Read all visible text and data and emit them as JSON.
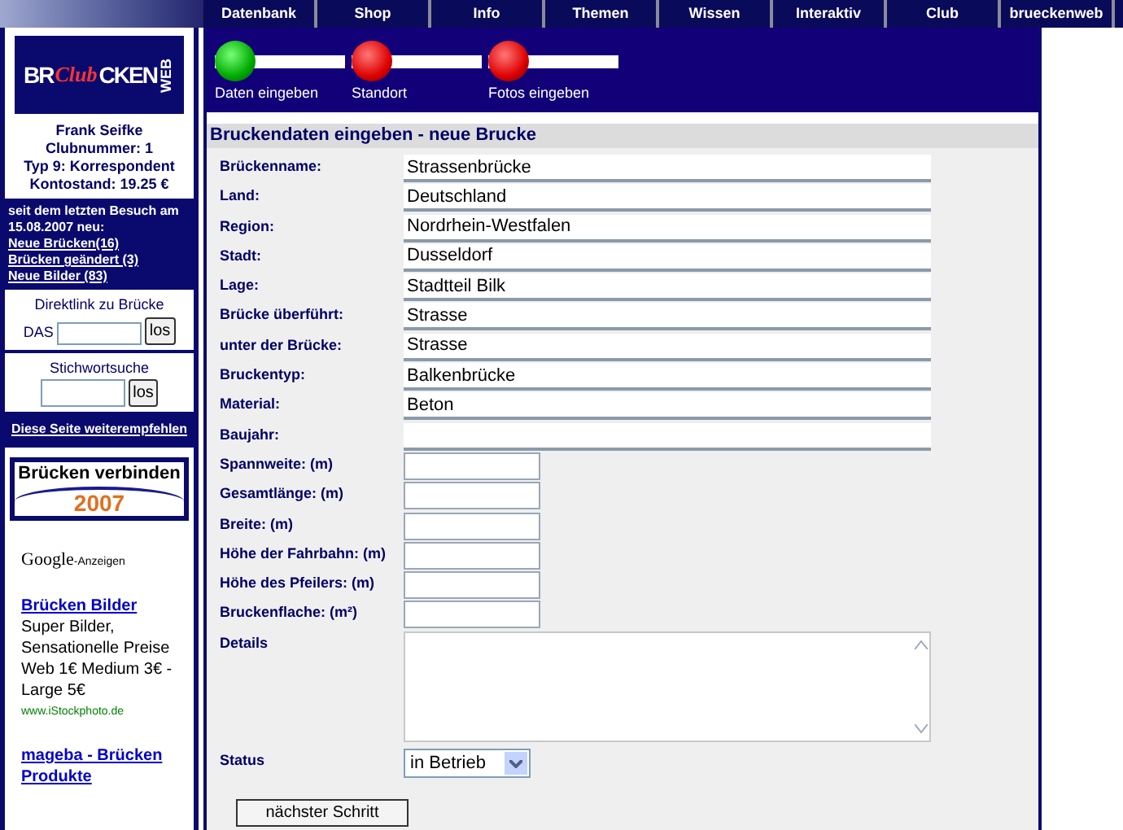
{
  "nav": [
    {
      "label": "Datenbank"
    },
    {
      "label": "Shop"
    },
    {
      "label": "Info"
    },
    {
      "label": "Themen"
    },
    {
      "label": "Wissen"
    },
    {
      "label": "Interaktiv"
    },
    {
      "label": "Club"
    },
    {
      "label": "brueckenweb"
    }
  ],
  "logo": {
    "left": "BR",
    "overlay": "Club",
    "right": "CKEN",
    "side": "WEB"
  },
  "user": [
    "Frank Seifke",
    "Clubnummer: 1",
    "Typ 9: Korrespondent",
    "Kontostand: 19.25 €"
  ],
  "news": {
    "intro": "seit dem letzten Besuch am 15.08.2007 neu:",
    "links": [
      "Neue Brücken(16)",
      "Brücken geändert (3)",
      "Neue Bilder (83)"
    ]
  },
  "direct_link": {
    "title": "Direktlink zu Brücke",
    "prefix": "DAS",
    "button": "los"
  },
  "keyword_search": {
    "title": "Stichwortsuche",
    "button": "los"
  },
  "recommend_link": "Diese Seite weiterempfehlen",
  "banner": {
    "title": "Brücken verbinden",
    "year": "2007"
  },
  "ads": {
    "brand": "Google",
    "label": "-Anzeigen",
    "items": [
      {
        "title": "Brücken Bilder",
        "text": "Super Bilder, Sensationelle Preise Web 1€ Medium 3€ - Large 5€",
        "url": "www.iStockphoto.de"
      },
      {
        "title": "mageba - Brücken Produkte"
      }
    ]
  },
  "steps": [
    {
      "label": "Daten eingeben",
      "done": true
    },
    {
      "label": "Standort",
      "done": false
    },
    {
      "label": "Fotos eingeben",
      "done": false
    }
  ],
  "form_title": "Bruckendaten eingeben - neue Brucke",
  "fields": [
    {
      "kind": "text",
      "label": "Brückenname:",
      "value": "Strassenbrücke"
    },
    {
      "kind": "text",
      "label": "Land:",
      "value": "Deutschland"
    },
    {
      "kind": "text",
      "label": "Region:",
      "value": "Nordrhein-Westfalen"
    },
    {
      "kind": "text",
      "label": "Stadt:",
      "value": "Dusseldorf"
    },
    {
      "kind": "text",
      "label": "Lage:",
      "value": "Stadtteil Bilk"
    },
    {
      "kind": "text",
      "label": "Brücke überführt:",
      "value": "Strasse"
    },
    {
      "kind": "text",
      "label": "unter der Brücke:",
      "value": "Strasse"
    },
    {
      "kind": "text",
      "label": "Bruckentyp:",
      "value": "Balkenbrücke"
    },
    {
      "kind": "text",
      "label": "Material:",
      "value": "Beton"
    },
    {
      "kind": "text",
      "label": "Baujahr:"
    },
    {
      "kind": "short",
      "label": "Spannweite: (m)"
    },
    {
      "kind": "short",
      "label": "Gesamtlänge: (m)"
    },
    {
      "kind": "short",
      "label": "Breite: (m)"
    },
    {
      "kind": "short",
      "label": "Höhe der Fahrbahn: (m)"
    },
    {
      "kind": "short",
      "label": "Höhe des Pfeilers: (m)"
    },
    {
      "kind": "short",
      "label": "Bruckenflache: (m²)"
    },
    {
      "kind": "textarea",
      "label": "Details"
    },
    {
      "kind": "select",
      "label": "Status",
      "value": "in Betrieb"
    }
  ],
  "submit": "nächster Schritt"
}
